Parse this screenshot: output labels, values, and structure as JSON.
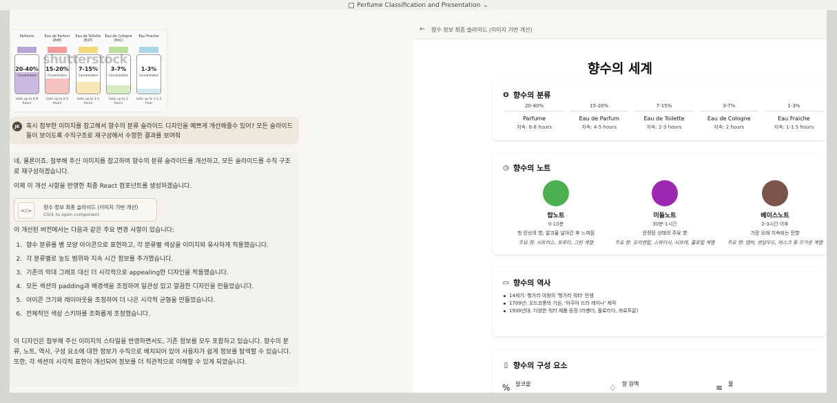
{
  "window": {
    "title": "Perfume Classification and Presentation"
  },
  "reference_image": {
    "watermark": "shutterstock",
    "bottles": [
      {
        "name": "Parfume",
        "pct": "20-40%",
        "conc": "Concentration",
        "last": "lasts up to 6-8 hours",
        "cap": "#b7a4d6",
        "fill": "#c9b9e3",
        "level": 0.55
      },
      {
        "name": "Eau de Parfum (EdP)",
        "pct": "15-20%",
        "conc": "Concentration",
        "last": "lasts up to 4-5 hours",
        "cap": "#f29a9a",
        "fill": "#f6c1c1",
        "level": 0.4
      },
      {
        "name": "Eau de Toilette (EdT)",
        "pct": "7-15%",
        "conc": "Concentration",
        "last": "lasts up to 2-3 hours",
        "cap": "#f5d77a",
        "fill": "#f7e8b5",
        "level": 0.3
      },
      {
        "name": "Eau de Cologne (EdC)",
        "pct": "3-7%",
        "conc": "Concentration",
        "last": "lasts up to 2 hours",
        "cap": "#b9dd9a",
        "fill": "#d6ebc2",
        "level": 0.22
      },
      {
        "name": "Eau Fraiche",
        "pct": "1-3%",
        "conc": "Concentration",
        "last": "lasts up to 1-1.5 hour",
        "cap": "#a9d5e8",
        "fill": "#d2e9f2",
        "level": 0.12
      }
    ]
  },
  "user_message": {
    "avatar": "JK",
    "text": "혹시 첨부한 이미지를 참고해서 향수의 분류 슬라이드 디자인을 예쁘게 개선해줄수 있어? 모든 슬라이드들이 보이도록 수직구조로 재구성해서 수정한 결과를 보여줘"
  },
  "assistant": {
    "p1": "네, 물론이죠. 첨부해 주신 이미지를 참고하여 향수의 분류 슬라이드를 개선하고, 모든 슬라이드를 수직 구조로 재구성하겠습니다.",
    "p2": "이제 이 개선 사항을 반영한 최종 React 컴포넌트를 생성하겠습니다.",
    "artifact": {
      "icon": "</>",
      "title": "향수 정보 최종 슬라이드 (이미지 기반 개선)",
      "subtitle": "Click to open component"
    },
    "p3": "이 개선된 버전에서는 다음과 같은 주요 변경 사항이 있습니다:",
    "list": [
      {
        "num": "1.",
        "text": "향수 분류를 병 모양 아이콘으로 표현하고, 각 분류별 색상을 이미지와 유사하게 적용했습니다."
      },
      {
        "num": "2.",
        "text": "각 분류별로 농도 범위와 지속 시간 정보를 추가했습니다."
      },
      {
        "num": "3.",
        "text": "기존의 막대 그래프 대신 더 시각적으로 appealing한 디자인을 적용했습니다."
      },
      {
        "num": "4.",
        "text": "모든 섹션의 padding과 배경색을 조정하여 일관성 있고 깔끔한 디자인을 만들었습니다."
      },
      {
        "num": "5.",
        "text": "아이콘 크기와 레이아웃을 조정하여 더 나은 시각적 균형을 만들었습니다."
      },
      {
        "num": "6.",
        "text": "전체적인 색상 스키마를 조화롭게 조정했습니다."
      }
    ],
    "p4": "이 디자인은 첨부해 주신 이미지의 스타일을 반영하면서도, 기존 정보를 모두 포함하고 있습니다. 향수의 분류, 노트, 역사, 구성 요소에 대한 정보가 수직으로 배치되어 있어 사용자가 쉽게 정보를 탐색할 수 있습니다. 또한, 각 섹션의 시각적 표현이 개선되어 정보를 더 직관적으로 이해할 수 있게 되었습니다."
  },
  "panel": {
    "back_icon": "←",
    "title": "향수 정보 최종 슬라이드 (이미지 기반 개선)",
    "main_title": "향수의 세계",
    "classification": {
      "heading": "향수의 분류",
      "icon": "droplets-icon",
      "items": [
        {
          "pct": "20-40%",
          "name": "Parfume",
          "dur": "지속: 6-8 hours"
        },
        {
          "pct": "15-20%",
          "name": "Eau de Parfum",
          "dur": "지속: 4-5 hours"
        },
        {
          "pct": "7-15%",
          "name": "Eau de Toilette",
          "dur": "지속: 2-3 hours"
        },
        {
          "pct": "3-7%",
          "name": "Eau de Cologne",
          "dur": "지속: 2 hours"
        },
        {
          "pct": "1-3%",
          "name": "Eau Fraiche",
          "dur": "지속: 1-1.5 hours"
        }
      ]
    },
    "notes": {
      "heading": "향수의 노트",
      "icon": "clock-icon",
      "items": [
        {
          "name": "탑노트",
          "time": "0-10분",
          "desc": "첫 인상의 향, 알코올 날아간 후 느껴짐",
          "ex": "주요 향: 시트러스, 프루티, 그린 계열",
          "color": "#4caf50"
        },
        {
          "name": "미들노트",
          "time": "30분-1시간",
          "desc": "안정된 상태의 주요 향",
          "ex": "주요 향: 오리엔탈, 스파이시, 시프레, 플로럴 계열",
          "color": "#9c27b0"
        },
        {
          "name": "베이스노트",
          "time": "2-3시간 이후",
          "desc": "가장 오래 지속되는 잔향",
          "ex": "주요 향: 앰버, 샌달우드, 머스크 등 무거운 계열",
          "color": "#795548"
        }
      ]
    },
    "history": {
      "heading": "향수의 역사",
      "icon": "book-icon",
      "items": [
        "14세기: 헝가리 여왕의 '헝가리 워터' 탄생",
        "1709년: 오드코롱의 기원, '아쿠아 드라 레지나' 제작",
        "1930년대: 다양한 워터 제품 등장 (라벤더, 플로리다, 프로투갈)"
      ]
    },
    "composition": {
      "heading": "향수의 구성 요소",
      "icon": "bottle-icon",
      "items": [
        {
          "icon": "%",
          "label": "알코올"
        },
        {
          "icon": "♢",
          "label": "향 원액"
        },
        {
          "icon": "≋",
          "label": "물"
        }
      ]
    }
  }
}
